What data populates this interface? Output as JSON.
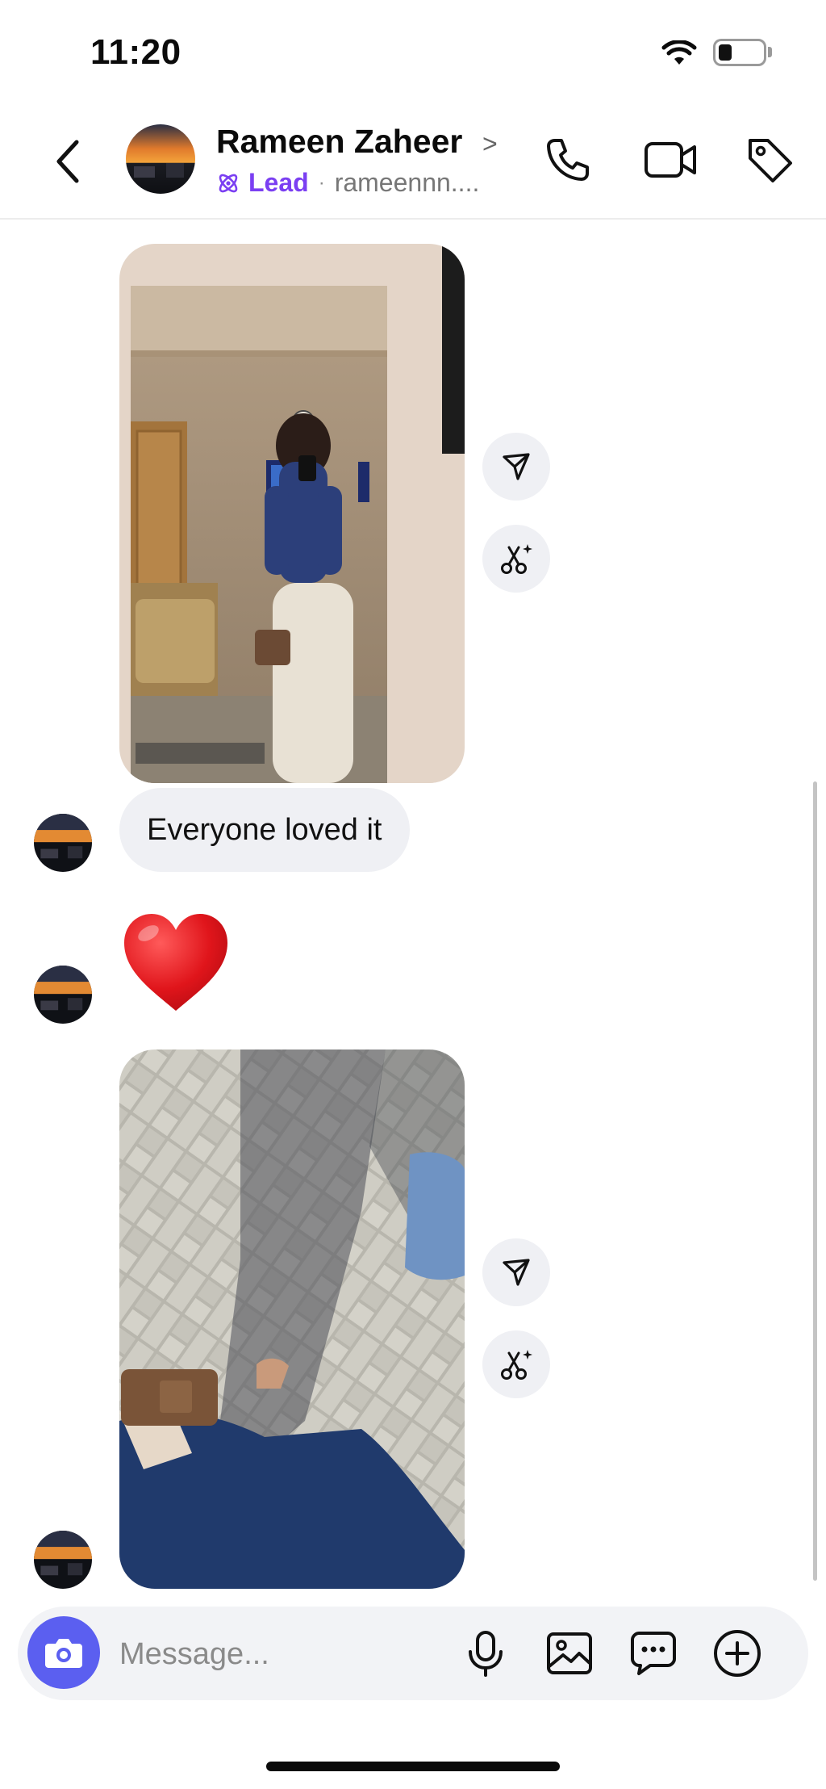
{
  "status_bar": {
    "time": "11:20",
    "battery_percent": 20
  },
  "header": {
    "contact_name": "Rameen Zaheer",
    "chevron": ">",
    "lead_label": "Lead",
    "separator": "·",
    "handle": "rameennn...."
  },
  "icons": {
    "back": "chevron-left-icon",
    "phone": "phone-icon",
    "video": "video-icon",
    "tag": "tag-icon",
    "share": "send-icon",
    "ai_edit": "ai-scissors-icon",
    "camera": "camera-icon",
    "mic": "microphone-icon",
    "gallery": "image-icon",
    "sticker": "chat-bubble-icon",
    "add": "plus-circle-icon"
  },
  "messages": [
    {
      "type": "photo",
      "description": "mirror selfie"
    },
    {
      "type": "text",
      "text": "Everyone loved it"
    },
    {
      "type": "emoji",
      "text": "❤️"
    },
    {
      "type": "photo",
      "description": "shadow on brick pavement"
    }
  ],
  "composer": {
    "placeholder": "Message..."
  },
  "colors": {
    "accent": "#5b5ff0",
    "lead": "#7b3ff2",
    "bubble": "#eff0f4"
  }
}
